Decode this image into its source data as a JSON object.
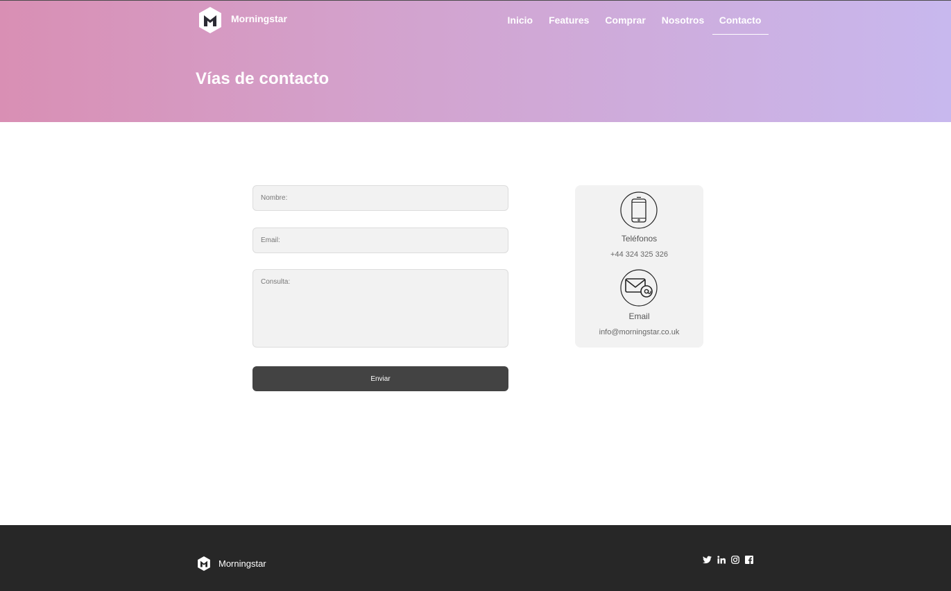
{
  "brand": {
    "name": "Morningstar"
  },
  "nav": {
    "items": [
      {
        "label": "Inicio"
      },
      {
        "label": "Features"
      },
      {
        "label": "Comprar"
      },
      {
        "label": "Nosotros"
      },
      {
        "label": "Contacto",
        "active": true
      }
    ]
  },
  "hero": {
    "title": "Vías de contacto"
  },
  "form": {
    "name_placeholder": "Nombre:",
    "name_value": "",
    "email_placeholder": "Email:",
    "email_value": "",
    "query_placeholder": "Consulta:",
    "query_value": "",
    "submit_label": "Enviar"
  },
  "contact": {
    "phone_icon": "smartphone-icon",
    "phone_label": "Teléfonos",
    "phone_value": "+44 324 325 326",
    "email_icon": "envelope-at-icon",
    "email_label": "Email",
    "email_value": "info@morningstar.co.uk"
  },
  "footer": {
    "brand_name": "Morningstar",
    "socials": [
      "twitter-icon",
      "linkedin-icon",
      "instagram-icon",
      "facebook-icon"
    ]
  },
  "colors": {
    "gradient_start": "#d98fb4",
    "gradient_end": "#c8b8ee",
    "button": "#434343",
    "footer": "#272727",
    "field_bg": "#f2f2f2"
  }
}
